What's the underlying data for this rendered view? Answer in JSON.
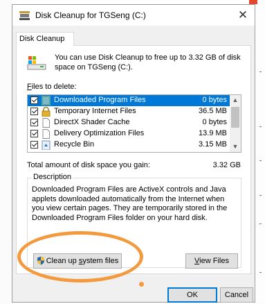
{
  "window": {
    "title": "Disk Cleanup for TGSeng (C:)",
    "close_glyph": "✕"
  },
  "tab": {
    "label": "Disk Cleanup"
  },
  "intro": {
    "text": "You can use Disk Cleanup to free up to 3.32 GB of disk space on TGSeng (C:)."
  },
  "files_to_delete": {
    "label_underlined": "F",
    "label_rest": "iles to delete:",
    "items": [
      {
        "name": "Downloaded Program Files",
        "size": "0 bytes",
        "checked": true,
        "selected": true,
        "icon": "folder-icon"
      },
      {
        "name": "Temporary Internet Files",
        "size": "36.5 MB",
        "checked": true,
        "selected": false,
        "icon": "lock-icon"
      },
      {
        "name": "DirectX Shader Cache",
        "size": "0 bytes",
        "checked": true,
        "selected": false,
        "icon": "file-icon"
      },
      {
        "name": "Delivery Optimization Files",
        "size": "13.9 MB",
        "checked": true,
        "selected": false,
        "icon": "file-icon"
      },
      {
        "name": "Recycle Bin",
        "size": "3.15 MB",
        "checked": true,
        "selected": false,
        "icon": "recycle-bin-icon"
      }
    ]
  },
  "total": {
    "label": "Total amount of disk space you gain:",
    "value": "3.32 GB"
  },
  "description": {
    "title": "Description",
    "text": "Downloaded Program Files are ActiveX controls and Java applets downloaded automatically from the Internet when you view certain pages. They are temporarily stored in the Downloaded Program Files folder on your hard disk."
  },
  "buttons": {
    "cleanup_system_pre": "Clean up ",
    "cleanup_system_u": "s",
    "cleanup_system_post": "ystem files",
    "view_u": "V",
    "view_rest": "iew Files",
    "ok": "OK",
    "cancel": "Cancel"
  },
  "colors": {
    "selection": "#0078d7",
    "annotation": "#f39a3e"
  }
}
